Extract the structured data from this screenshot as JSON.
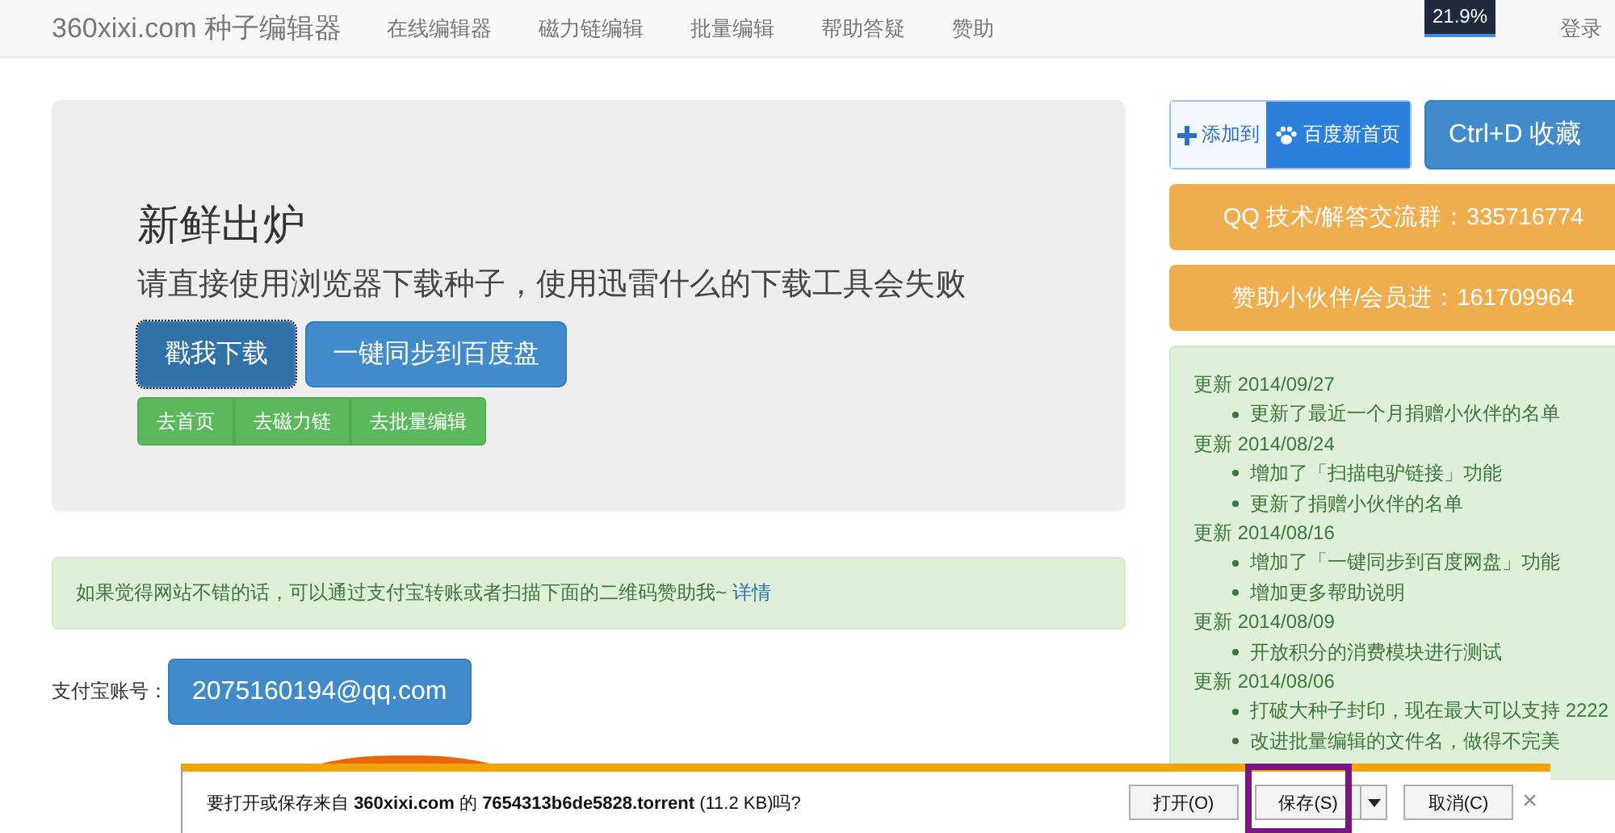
{
  "navbar": {
    "brand": "360xixi.com 种子编辑器",
    "links": [
      "在线编辑器",
      "磁力链编辑",
      "批量编辑",
      "帮助答疑",
      "赞助"
    ],
    "progress": "21.9%",
    "login": "登录"
  },
  "jumbotron": {
    "title": "新鲜出炉",
    "subtitle": "请直接使用浏览器下载种子，使用迅雷什么的下载工具会失败",
    "buttons": [
      {
        "label": "戳我下载",
        "kind": "active"
      },
      {
        "label": "一键同步到百度盘",
        "kind": "normal"
      }
    ],
    "links": [
      "去首页",
      "去磁力链",
      "去批量编辑"
    ]
  },
  "alert": {
    "text": "如果觉得网站不错的话，可以通过支付宝转账或者扫描下面的二维码赞助我~",
    "link": "详情"
  },
  "payment": {
    "label": "支付宝账号：",
    "account": "2075160194@qq.com"
  },
  "sidebar": {
    "add_button": {
      "prefix": "添加到",
      "label": "百度新首页"
    },
    "bookmark": "Ctrl+D 收藏",
    "banners": [
      "QQ 技术/解答交流群：335716774",
      "赞助小伙伴/会员进：161709964"
    ],
    "updates": [
      {
        "date": "更新 2014/09/27",
        "items": [
          "更新了最近一个月捐赠小伙伴的名单"
        ]
      },
      {
        "date": "更新 2014/08/24",
        "items": [
          "增加了「扫描电驴链接」功能",
          "更新了捐赠小伙伴的名单"
        ]
      },
      {
        "date": "更新 2014/08/16",
        "items": [
          "增加了「一键同步到百度网盘」功能",
          "增加更多帮助说明"
        ]
      },
      {
        "date": "更新 2014/08/09",
        "items": [
          "开放积分的消费模块进行测试"
        ]
      },
      {
        "date": "更新 2014/08/06",
        "items": [
          "打破大种子封印，现在最大可以支持 2222",
          "改进批量编辑的文件名，做得不完美"
        ]
      }
    ]
  },
  "download_bar": {
    "message": "要打开或保存来自 **360xixi.com** 的 **7654313b6de5828.torrent** (11.2 KB)吗?",
    "buttons": [
      {
        "label": "打开(O)",
        "kind": "plain",
        "highlighted": false
      },
      {
        "label": "保存(S)",
        "kind": "split",
        "highlighted": true
      },
      {
        "label": "取消(C)",
        "kind": "plain",
        "highlighted": false
      }
    ],
    "close": "×"
  }
}
